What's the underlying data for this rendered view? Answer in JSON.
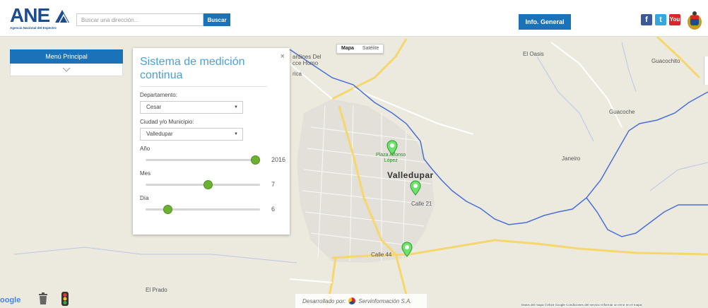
{
  "header": {
    "logo_text": "ANE",
    "logo_subtitle": "Agencia Nacional del Espectro",
    "search_placeholder": "Buscar una dirección...",
    "search_button": "Buscar",
    "info_button": "Info. General",
    "social": [
      {
        "name": "facebook",
        "glyph": "f"
      },
      {
        "name": "twitter",
        "glyph": "t"
      },
      {
        "name": "youtube",
        "glyph": "You"
      }
    ]
  },
  "menu": {
    "title": "Menú Principal"
  },
  "panel": {
    "title": "Sistema de medición continua",
    "close": "×",
    "departamento_label": "Departamento:",
    "departamento_value": "Cesar",
    "municipio_label": "Ciudad y/o Municipio:",
    "municipio_value": "Valledupar",
    "sliders": [
      {
        "label": "Año",
        "value": "2016",
        "fraction": 1.0
      },
      {
        "label": "Mes",
        "value": "7",
        "fraction": 0.55
      },
      {
        "label": "Día",
        "value": "6",
        "fraction": 0.17
      }
    ]
  },
  "map": {
    "type_buttons": {
      "map": "Mapa",
      "satellite": "Satélite"
    },
    "city": "Valledupar",
    "labels": {
      "jardines": "ardines Del\ncce Homo",
      "rica": "rica",
      "el_oasis": "El Oasis",
      "guacochito": "Guacochito",
      "guacoche": "Guacoche",
      "janeiro": "Janeiro",
      "el_prado": "El Prado",
      "plaza": "Plaza Alfonso\nLópez",
      "calle21": "Calle 21",
      "calle44": "Calle 44"
    },
    "copyright": "Datos del mapa ©2016 Google   Condiciones del servicio   Informar un error en el mapa",
    "google": "oogle"
  },
  "footer": {
    "prefix": "Desarrollado por:",
    "company": "Servinformación S.A."
  },
  "colors": {
    "primary": "#1a73b8",
    "title": "#4b9fd6",
    "slider": "#6bb132",
    "river": "#4a6fd9",
    "road": "#f5d76e"
  }
}
